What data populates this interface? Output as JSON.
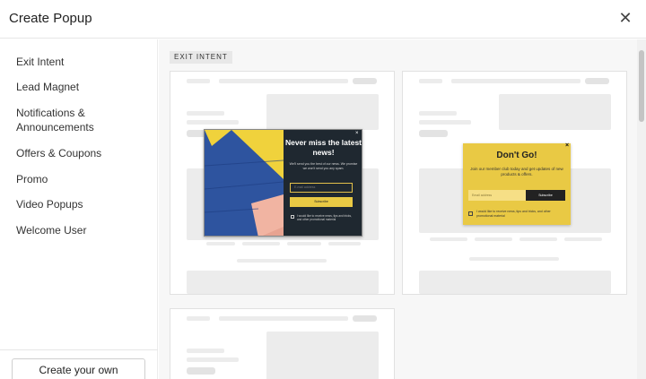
{
  "header": {
    "title": "Create Popup",
    "close_glyph": "✕"
  },
  "sidebar": {
    "items": [
      {
        "label": "Exit Intent"
      },
      {
        "label": "Lead Magnet"
      },
      {
        "label": "Notifications & Announcements"
      },
      {
        "label": "Offers & Coupons"
      },
      {
        "label": "Promo"
      },
      {
        "label": "Video Popups"
      },
      {
        "label": "Welcome User"
      }
    ],
    "create_label": "Create your own"
  },
  "main": {
    "section_tag": "EXIT INTENT"
  },
  "templates": [
    {
      "headline": "Never miss the latest news!",
      "body": "We'll send you the best of our news. We promise we won't send you any spam.",
      "input_placeholder": "E-mail address",
      "button_label": "Subscribe",
      "consent": "I would like to receive news, tips and tricks, and other promotional material",
      "close_glyph": "×",
      "colors": {
        "bg": "#1f2830",
        "accent": "#e9c944"
      }
    },
    {
      "headline": "Don't Go!",
      "body": "Join our member club today and get updates of new products & offers.",
      "input_placeholder": "Email address",
      "button_label": "Subscribe",
      "consent": "I would like to receive news, tips and tricks, and other promotional material",
      "close_glyph": "×",
      "colors": {
        "bg": "#e9c944",
        "button": "#222222"
      }
    }
  ]
}
